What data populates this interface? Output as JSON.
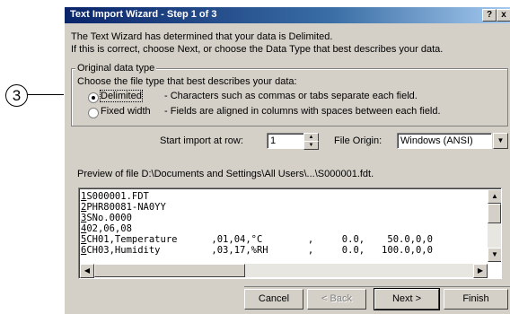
{
  "callout": {
    "label": "3"
  },
  "window": {
    "title": "Text Import Wizard - Step 1 of 3",
    "help_button": "?",
    "close_button": "x"
  },
  "intro": {
    "line1": "The Text Wizard has determined that your data is Delimited.",
    "line2": "If this is correct, choose Next, or choose the Data Type that best describes your data."
  },
  "data_type": {
    "group_label": "Original data type",
    "prompt": "Choose the file type that best describes your data:",
    "options": [
      {
        "label": "Delimited",
        "description": "- Characters such as commas or tabs separate each field.",
        "selected": true
      },
      {
        "label": "Fixed width",
        "description": "- Fields are aligned in columns with spaces between each field.",
        "selected": false
      }
    ]
  },
  "import_settings": {
    "start_row_label": "Start import at row:",
    "start_row_value": "1",
    "file_origin_label": "File Origin:",
    "file_origin_value": "Windows (ANSI)"
  },
  "preview": {
    "label": "Preview of file D:\\Documents and Settings\\All Users\\...\\S000001.fdt.",
    "rows": [
      {
        "num": "1",
        "text": "S000001.FDT"
      },
      {
        "num": "2",
        "text": "PHR80081-NA0YY"
      },
      {
        "num": "3",
        "text": "SNo.0000"
      },
      {
        "num": "4",
        "text": "02,06,08"
      },
      {
        "num": "5",
        "text": "CH01,Temperature      ,01,04,°C        ,     0.0,    50.0,0,0"
      },
      {
        "num": "6",
        "text": "CH03,Humidity         ,03,17,%RH       ,     0.0,   100.0,0,0"
      }
    ]
  },
  "buttons": {
    "cancel": "Cancel",
    "back": "< Back",
    "next": "Next >",
    "finish": "Finish"
  }
}
